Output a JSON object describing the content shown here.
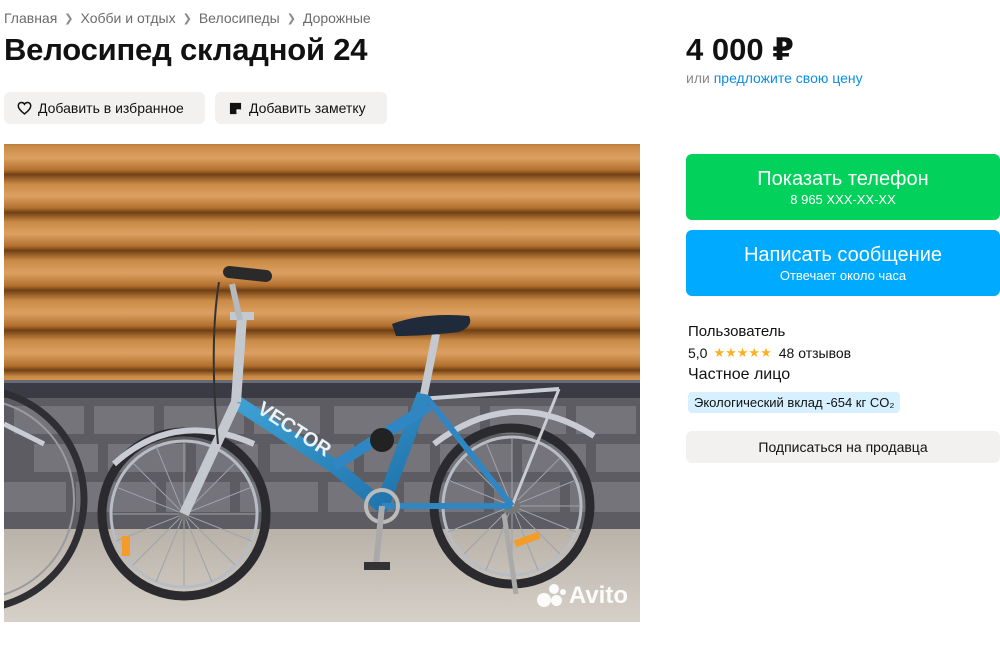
{
  "breadcrumb": {
    "items": [
      {
        "label": "Главная"
      },
      {
        "label": "Хобби и отдых"
      },
      {
        "label": "Велосипеды"
      },
      {
        "label": "Дорожные"
      }
    ]
  },
  "listing": {
    "title": "Велосипед складной 24",
    "favorite_label": "Добавить в избранное",
    "note_label": "Добавить заметку",
    "photo_alt_brand": "VECTOR",
    "watermark": "Avito"
  },
  "price": {
    "value": "4 000 ₽",
    "offer_prefix": "или",
    "offer_link": "предложите свою цену"
  },
  "contact": {
    "phone_label": "Показать телефон",
    "phone_masked": "8 965 XXX-XX-XX",
    "message_label": "Написать сообщение",
    "message_sub": "Отвечает около часа"
  },
  "seller": {
    "name": "Пользователь",
    "rating": "5,0",
    "stars": "★★★★★",
    "reviews": "48 отзывов",
    "type": "Частное лицо",
    "eco": "Экологический вклад -654 кг CO₂",
    "subscribe_label": "Подписаться на продавца"
  },
  "colors": {
    "green": "#02d15c",
    "blue": "#00aaff",
    "link": "#0a8ee6",
    "star": "#ffb021"
  }
}
